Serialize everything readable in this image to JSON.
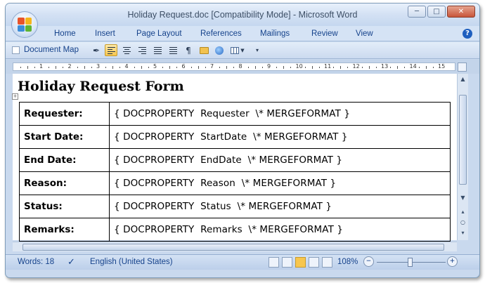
{
  "window": {
    "title": "Holiday Request.doc [Compatibility Mode] - Microsoft Word",
    "controls": [
      "minimize-icon",
      "maximize-icon",
      "close-icon"
    ]
  },
  "ribbon": {
    "tabs": [
      "Home",
      "Insert",
      "Page Layout",
      "References",
      "Mailings",
      "Review",
      "View"
    ],
    "help_icon": "?"
  },
  "toolbar": {
    "document_map_label": "Document Map",
    "document_map_checked": false,
    "pilcrow": "¶",
    "active_alignment": "align-left"
  },
  "ruler": {
    "numbers": [
      "1",
      "2",
      "3",
      "4",
      "5",
      "6",
      "7",
      "8",
      "9",
      "10",
      "11",
      "12",
      "13",
      "14",
      "15"
    ]
  },
  "document": {
    "title": "Holiday Request Form",
    "field_prefix": "{ DOCPROPERTY",
    "field_suffix": "\\* MERGEFORMAT }",
    "rows": [
      {
        "label": "Requester:",
        "property": "Requester"
      },
      {
        "label": "Start Date:",
        "property": "StartDate"
      },
      {
        "label": "End Date:",
        "property": "EndDate"
      },
      {
        "label": "Reason:",
        "property": "Reason"
      },
      {
        "label": "Status:",
        "property": "Status"
      },
      {
        "label": "Remarks:",
        "property": "Remarks"
      }
    ]
  },
  "status": {
    "words": "Words: 18",
    "language": "English (United States)",
    "zoom": "108%",
    "zoom_minus": "−",
    "zoom_plus": "+"
  },
  "colors": {
    "chrome": "#c9d9ee",
    "tab_text": "#15428b",
    "active_button": "#f7c64e"
  }
}
